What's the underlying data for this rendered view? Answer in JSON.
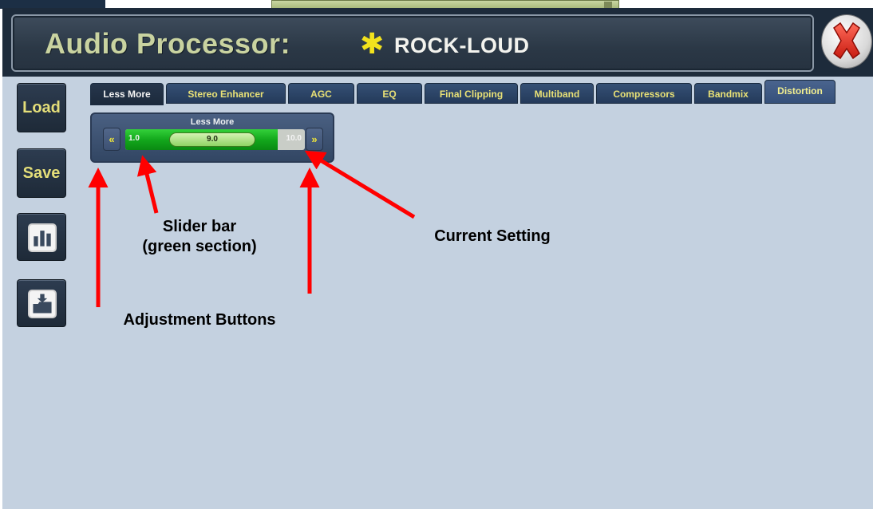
{
  "header": {
    "title": "Audio Processor:",
    "preset_marker": "✱",
    "preset_name": "ROCK-LOUD"
  },
  "sidebar": {
    "load_label": "Load",
    "save_label": "Save",
    "icons": [
      "bar-chart-icon",
      "download-folder-icon"
    ]
  },
  "tabs": [
    {
      "label": "Less More",
      "active": true
    },
    {
      "label": "Stereo Enhancer"
    },
    {
      "label": "AGC"
    },
    {
      "label": "EQ"
    },
    {
      "label": "Final Clipping"
    },
    {
      "label": "Multiband"
    },
    {
      "label": "Compressors"
    },
    {
      "label": "Bandmix"
    },
    {
      "label": "Distortion"
    }
  ],
  "slider": {
    "title": "Less More",
    "decrease_label": "«",
    "increase_label": "»",
    "min": "1.0",
    "max": "10.0",
    "value": "9.0",
    "fill_fraction": 0.85
  },
  "annotations": {
    "slider_bar": "Slider bar\n(green section)",
    "slider_bar_line1": "Slider bar",
    "slider_bar_line2": "(green section)",
    "current_setting": "Current Setting",
    "adjustment_buttons": "Adjustment Buttons"
  },
  "colors": {
    "accent_yellow": "#f2e21d",
    "panel_bg": "#c4d1e0",
    "header_bg": "#2b3846",
    "arrow_red": "#ff0000"
  }
}
